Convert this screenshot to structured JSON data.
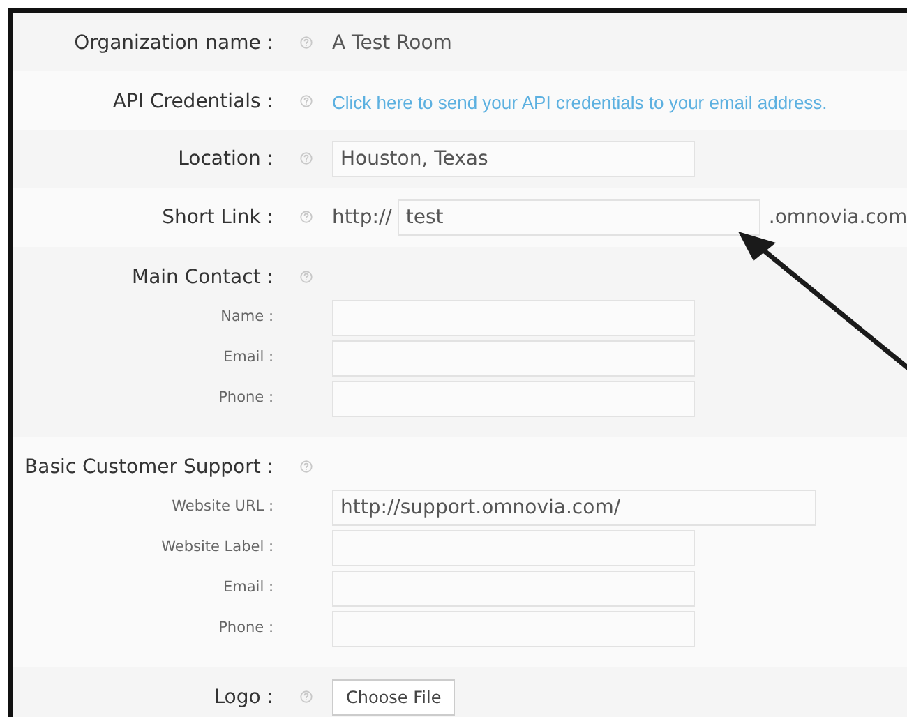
{
  "rows": [
    {
      "kind": "text",
      "label": "Organization name :",
      "value": "A Test Room"
    },
    {
      "kind": "link",
      "label": "API Credentials :",
      "link": "Click here to send your API credentials to your email address."
    },
    {
      "kind": "input",
      "label": "Location :",
      "value": "Houston, Texas"
    },
    {
      "kind": "shortlink",
      "label": "Short Link :",
      "prefix": "http://",
      "value": "test",
      "suffix": ".omnovia.com"
    },
    {
      "kind": "group",
      "label": "Main Contact :",
      "fields": [
        {
          "label": "Name :"
        },
        {
          "label": "Email :"
        },
        {
          "label": "Phone :"
        }
      ]
    },
    {
      "kind": "group",
      "label": "Basic Customer Support :",
      "fields": [
        {
          "label": "Website URL :",
          "value": "http://support.omnovia.com/",
          "wide": true
        },
        {
          "label": "Website Label :"
        },
        {
          "label": "Email :"
        },
        {
          "label": "Phone :"
        }
      ]
    },
    {
      "kind": "file",
      "label": "Logo :",
      "button": "Choose File"
    }
  ]
}
